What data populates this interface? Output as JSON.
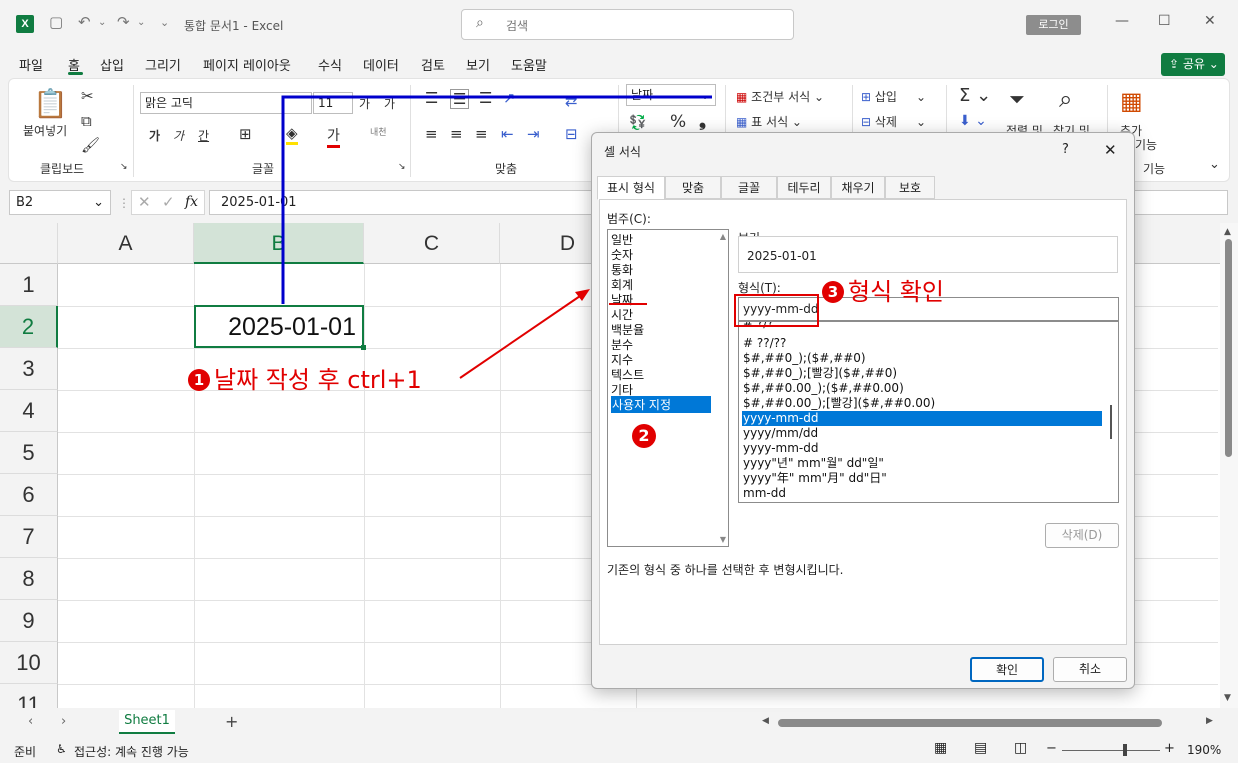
{
  "titlebar": {
    "logo": "X",
    "doc_title": "통합 문서1 - Excel",
    "search_placeholder": "검색",
    "login": "로그인"
  },
  "menu": {
    "items": [
      "파일",
      "홈",
      "삽입",
      "그리기",
      "페이지 레이아웃",
      "수식",
      "데이터",
      "검토",
      "보기",
      "도움말"
    ],
    "share": "공유"
  },
  "ribbon": {
    "clipboard": {
      "paste": "붙여넣기",
      "label": "클립보드"
    },
    "font": {
      "name": "맑은 고딕",
      "size": "11",
      "bold": "가",
      "italic": "가",
      "underline": "간",
      "label": "글꼴"
    },
    "alignment": {
      "label": "맞춤"
    },
    "number": {
      "format": "날짜"
    },
    "styles": {
      "conditional": "조건부 서식",
      "table": "표 서식"
    },
    "cells": {
      "insert": "삽입",
      "delete": "삭제"
    },
    "editing": {
      "sort": "정렬 및",
      "find": "찾기 및"
    },
    "addins": {
      "label": "추가",
      "label2": "기능",
      "group": "기능"
    }
  },
  "formula_bar": {
    "namebox": "B2",
    "fx": "fx",
    "value": "2025-01-01"
  },
  "grid": {
    "columns": [
      "A",
      "B",
      "C",
      "D"
    ],
    "rows": [
      "1",
      "2",
      "3",
      "4",
      "5",
      "6",
      "7",
      "8",
      "9",
      "10",
      "11"
    ],
    "b2": "2025-01-01"
  },
  "sheets": {
    "tab": "Sheet1",
    "add": "+"
  },
  "status": {
    "ready": "준비",
    "accessibility": "접근성: 계속 진행 가능",
    "zoom": "190%"
  },
  "dialog": {
    "title": "셀 서식",
    "help": "?",
    "tabs": [
      "표시 형식",
      "맞춤",
      "글꼴",
      "테두리",
      "채우기",
      "보호"
    ],
    "category_label": "범주(C):",
    "categories": [
      "일반",
      "숫자",
      "통화",
      "회계",
      "날짜",
      "시간",
      "백분율",
      "분수",
      "지수",
      "텍스트",
      "기타",
      "사용자 지정"
    ],
    "preview_label": "보기",
    "preview_value": "2025-01-01",
    "type_label": "형식(T):",
    "type_value": "yyyy-mm-dd",
    "formats": [
      "# ?/?",
      "# ??/??",
      "$#,##0_);($#,##0)",
      "$#,##0_);[빨강]($#,##0)",
      "$#,##0.00_);($#,##0.00)",
      "$#,##0.00_);[빨강]($#,##0.00)",
      "yyyy-mm-dd",
      "yyyy/mm/dd",
      "yyyy-mm-dd",
      "yyyy\"년\" mm\"월\" dd\"일\"",
      "yyyy\"年\" mm\"月\" dd\"日\"",
      "mm-dd"
    ],
    "delete": "삭제(D)",
    "hint": "기존의 형식 중 하나를 선택한 후 변형시킵니다.",
    "ok": "확인",
    "cancel": "취소"
  },
  "annotations": {
    "step1": "날짜 작성 후 ctrl+1",
    "step2": "2",
    "step3": "형식 확인",
    "n1": "1",
    "n3": "3",
    "color": "#e10000",
    "line_color": "#0000cc"
  }
}
